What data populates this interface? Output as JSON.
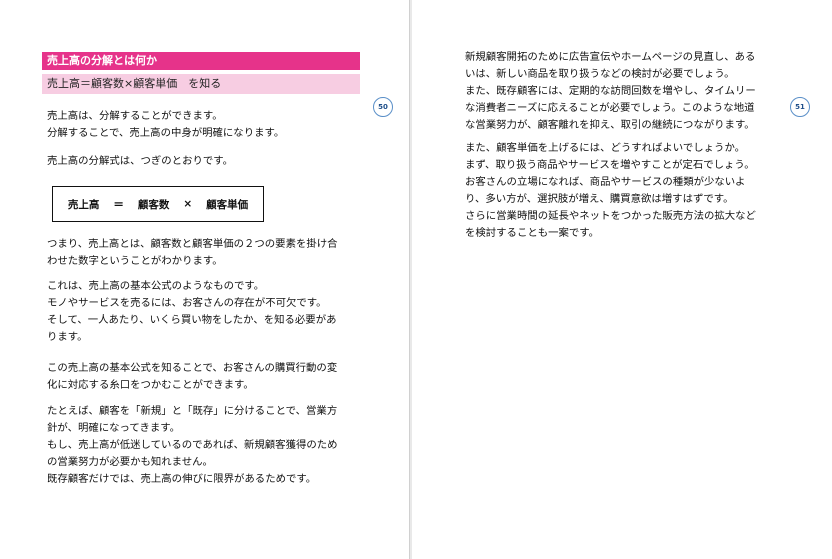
{
  "left_page": {
    "heading": "売上高の分解とは何か",
    "subheading": "売上高＝顧客数×顧客単価　を知る",
    "page_number": "50",
    "formula": {
      "term1": "売上高",
      "op1": "＝",
      "term2": "顧客数",
      "op2": "×",
      "term3": "顧客単価"
    },
    "paragraphs": [
      "売上高は、分解することができます。\n分解することで、売上高の中身が明確になります。",
      "売上高の分解式は、つぎのとおりです。",
      "つまり、売上高とは、顧客数と顧客単価の２つの要素を掛け合\nわせた数字ということがわかります。",
      "これは、売上高の基本公式のようなものです。\nモノやサービスを売るには、お客さんの存在が不可欠です。\nそして、一人あたり、いくら買い物をしたか、を知る必要があ\nります。",
      "この売上高の基本公式を知ることで、お客さんの購買行動の変\n化に対応する糸口をつかむことができます。",
      "たとえば、顧客を「新規」と「既存」に分けることで、営業方\n針が、明確になってきます。\nもし、売上高が低迷しているのであれば、新規顧客獲得のため\nの営業努力が必要かも知れません。\n既存顧客だけでは、売上高の伸びに限界があるためです。"
    ]
  },
  "right_page": {
    "page_number": "51",
    "paragraphs": [
      "新規顧客開拓のために広告宣伝やホームページの見直し、ある\nいは、新しい商品を取り扱うなどの検討が必要でしょう。\nまた、既存顧客には、定期的な訪問回数を増やし、タイムリー\nな消費者ニーズに応えることが必要でしょう。このような地道\nな営業努力が、顧客離れを抑え、取引の継続につながります。",
      "また、顧客単価を上げるには、どうすればよいでしょうか。\nまず、取り扱う商品やサービスを増やすことが定石でしょう。\nお客さんの立場になれば、商品やサービスの種類が少ないよ\nり、多い方が、選択肢が増え、購買意欲は増すはずです。\nさらに営業時間の延長やネットをつかった販売方法の拡大など\nを検討することも一案です。"
    ]
  }
}
